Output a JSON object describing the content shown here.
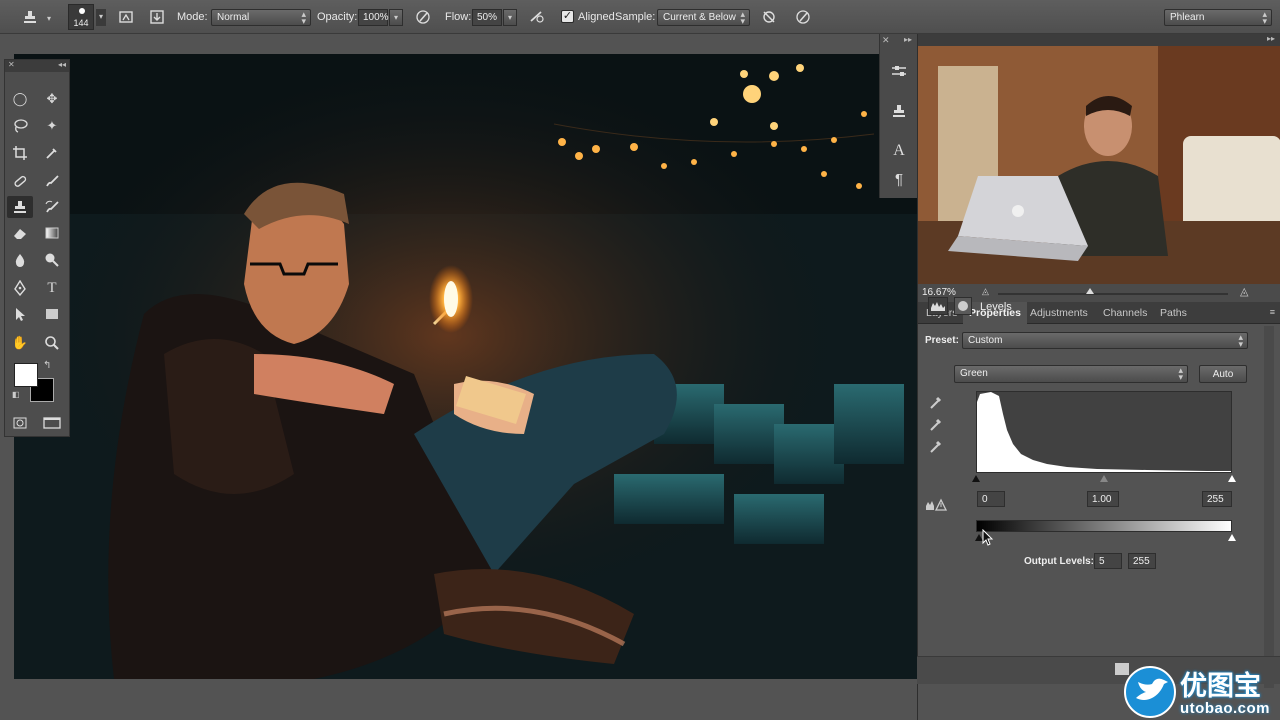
{
  "options_bar": {
    "brush_size": "144",
    "mode_label": "Mode:",
    "mode_value": "Normal",
    "opacity_label": "Opacity:",
    "opacity_value": "100%",
    "flow_label": "Flow:",
    "flow_value": "50%",
    "aligned_label": "Aligned",
    "aligned_checked": true,
    "sample_label": "Sample:",
    "sample_value": "Current & Below",
    "workspace_value": "Phlearn"
  },
  "tools": {
    "icons": [
      "marquee-icon",
      "move-icon",
      "lasso-icon",
      "magic-wand-icon",
      "crop-icon",
      "eyedropper-icon",
      "healing-brush-icon",
      "brush-icon",
      "clone-stamp-icon",
      "history-brush-icon",
      "eraser-icon",
      "gradient-icon",
      "blur-icon",
      "dodge-icon",
      "pen-icon",
      "type-icon",
      "path-selection-icon",
      "rectangle-icon",
      "hand-icon",
      "zoom-icon"
    ],
    "type_glyph": "T"
  },
  "dock": {
    "type_glyph": "A"
  },
  "navigator": {
    "zoom": "16.67%"
  },
  "panel_tabs": [
    {
      "label": "Layers"
    },
    {
      "label": "Properties"
    },
    {
      "label": "Adjustments"
    },
    {
      "label": "Channels"
    },
    {
      "label": "Paths"
    }
  ],
  "properties": {
    "title": "Levels",
    "preset_label": "Preset:",
    "preset_value": "Custom",
    "channel_value": "Green",
    "auto_label": "Auto",
    "input_black": "0",
    "input_gamma": "1.00",
    "input_white": "255",
    "output_label": "Output Levels:",
    "output_black": "5",
    "output_white": "255"
  },
  "watermark": {
    "name": "优图宝",
    "url": "utobao.com"
  }
}
